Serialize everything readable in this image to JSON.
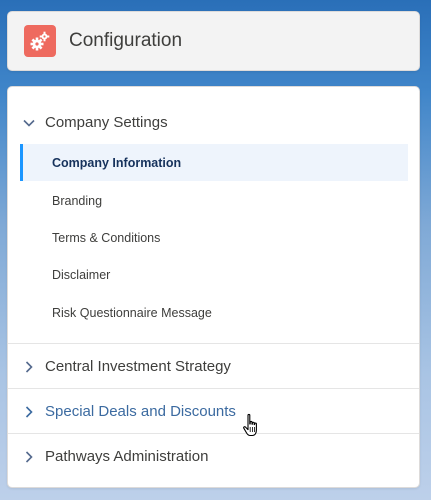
{
  "header": {
    "title": "Configuration",
    "icon": "gears-icon",
    "icon_color": "#ee6a5f"
  },
  "nav": {
    "sections": [
      {
        "label": "Company Settings",
        "expanded": true,
        "items": [
          {
            "label": "Company Information",
            "active": true
          },
          {
            "label": "Branding",
            "active": false
          },
          {
            "label": "Terms & Conditions",
            "active": false
          },
          {
            "label": "Disclaimer",
            "active": false
          },
          {
            "label": "Risk Questionnaire Message",
            "active": false
          }
        ]
      },
      {
        "label": "Central Investment Strategy",
        "expanded": false,
        "hovered": false
      },
      {
        "label": "Special Deals and Discounts",
        "expanded": false,
        "hovered": true
      },
      {
        "label": "Pathways Administration",
        "expanded": false,
        "hovered": false
      }
    ]
  },
  "colors": {
    "active_indicator": "#1b96ff",
    "hover_link": "#3b6aa0"
  }
}
